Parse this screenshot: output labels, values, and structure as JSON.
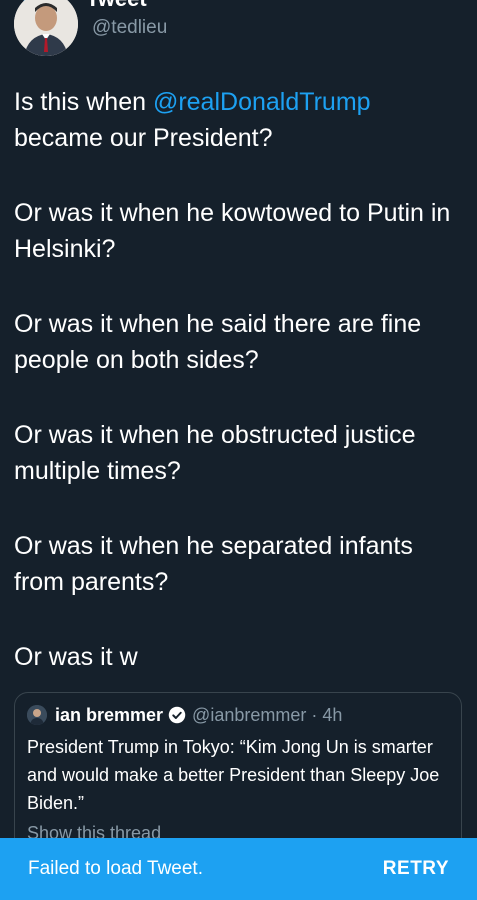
{
  "header": {
    "title": "Tweet",
    "back_icon": "back-arrow-icon"
  },
  "author": {
    "handle": "@tedlieu",
    "avatar_icon": "avatar-photo"
  },
  "tweet": {
    "p1_before": "Is this when ",
    "p1_mention": "@realDonaldTrump",
    "p1_after": " became our President?",
    "p2": "Or was it when he kowtowed to Putin in Helsinki?",
    "p3": "Or was it when he said there are fine people on both sides?",
    "p4": "Or was it when he obstructed justice multiple times?",
    "p5": "Or was it when he separated infants from parents?",
    "p6": "Or was it w"
  },
  "quote": {
    "name": "ian bremmer",
    "verified_icon": "verified-badge-icon",
    "handle_time": "@ianbremmer · 4h",
    "text": "President Trump in Tokyo: “Kim Jong Un is smarter and would make a better President than Sleepy Joe Biden.”",
    "show_thread": "Show this thread"
  },
  "snackbar": {
    "message": "Failed to load Tweet.",
    "action": "RETRY"
  },
  "colors": {
    "background": "#15202b",
    "accent": "#1da1f2",
    "secondary_text": "#8899a6",
    "border": "#38444d"
  }
}
